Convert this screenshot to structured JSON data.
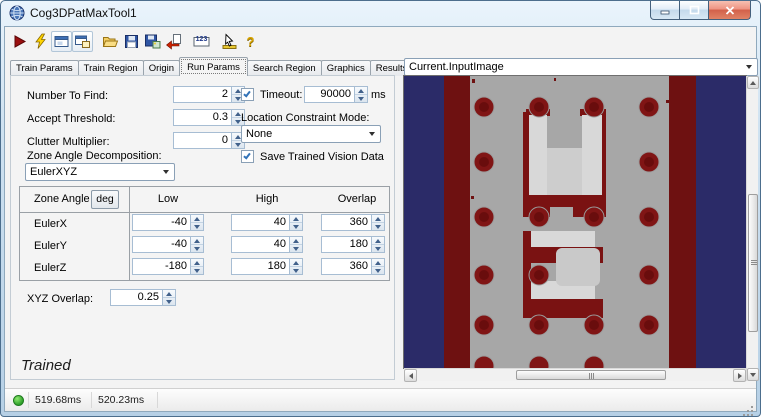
{
  "window": {
    "title": "Cog3DPatMaxTool1"
  },
  "toolbar": {
    "results_text": "123",
    "help_text": "?"
  },
  "tabs": {
    "items": [
      "Train Params",
      "Train Region",
      "Origin",
      "Run Params",
      "Search Region",
      "Graphics",
      "Results"
    ],
    "active": "Run Params"
  },
  "run_params": {
    "number_to_find": {
      "label": "Number To Find:",
      "value": "2"
    },
    "accept_threshold": {
      "label": "Accept Threshold:",
      "value": "0.3"
    },
    "clutter_multiplier": {
      "label": "Clutter Multiplier:",
      "value": "0"
    },
    "zone_angle_decomposition": {
      "label": "Zone Angle Decomposition:",
      "value": "EulerXYZ"
    },
    "timeout": {
      "label": "Timeout:",
      "value": "90000",
      "unit": "ms",
      "checked": true
    },
    "location_constraint_mode": {
      "label": "Location Constraint Mode:",
      "value": "None"
    },
    "save_trained_vision_data": {
      "label": "Save Trained Vision Data",
      "checked": true
    },
    "zone_table": {
      "col_header": "Zone Angle",
      "deg_button": "deg",
      "columns": [
        "Low",
        "High",
        "Overlap"
      ],
      "rows": [
        {
          "name": "EulerX",
          "low": "-40",
          "high": "40",
          "overlap": "360"
        },
        {
          "name": "EulerY",
          "low": "-40",
          "high": "40",
          "overlap": "180"
        },
        {
          "name": "EulerZ",
          "low": "-180",
          "high": "180",
          "overlap": "360"
        }
      ]
    },
    "xyz_overlap": {
      "label": "XYZ Overlap:",
      "value": "0.25"
    },
    "state": "Trained"
  },
  "image_panel": {
    "selected_view": "Current.InputImage"
  },
  "status_bar": {
    "time1": "519.68ms",
    "time2": "520.23ms"
  }
}
